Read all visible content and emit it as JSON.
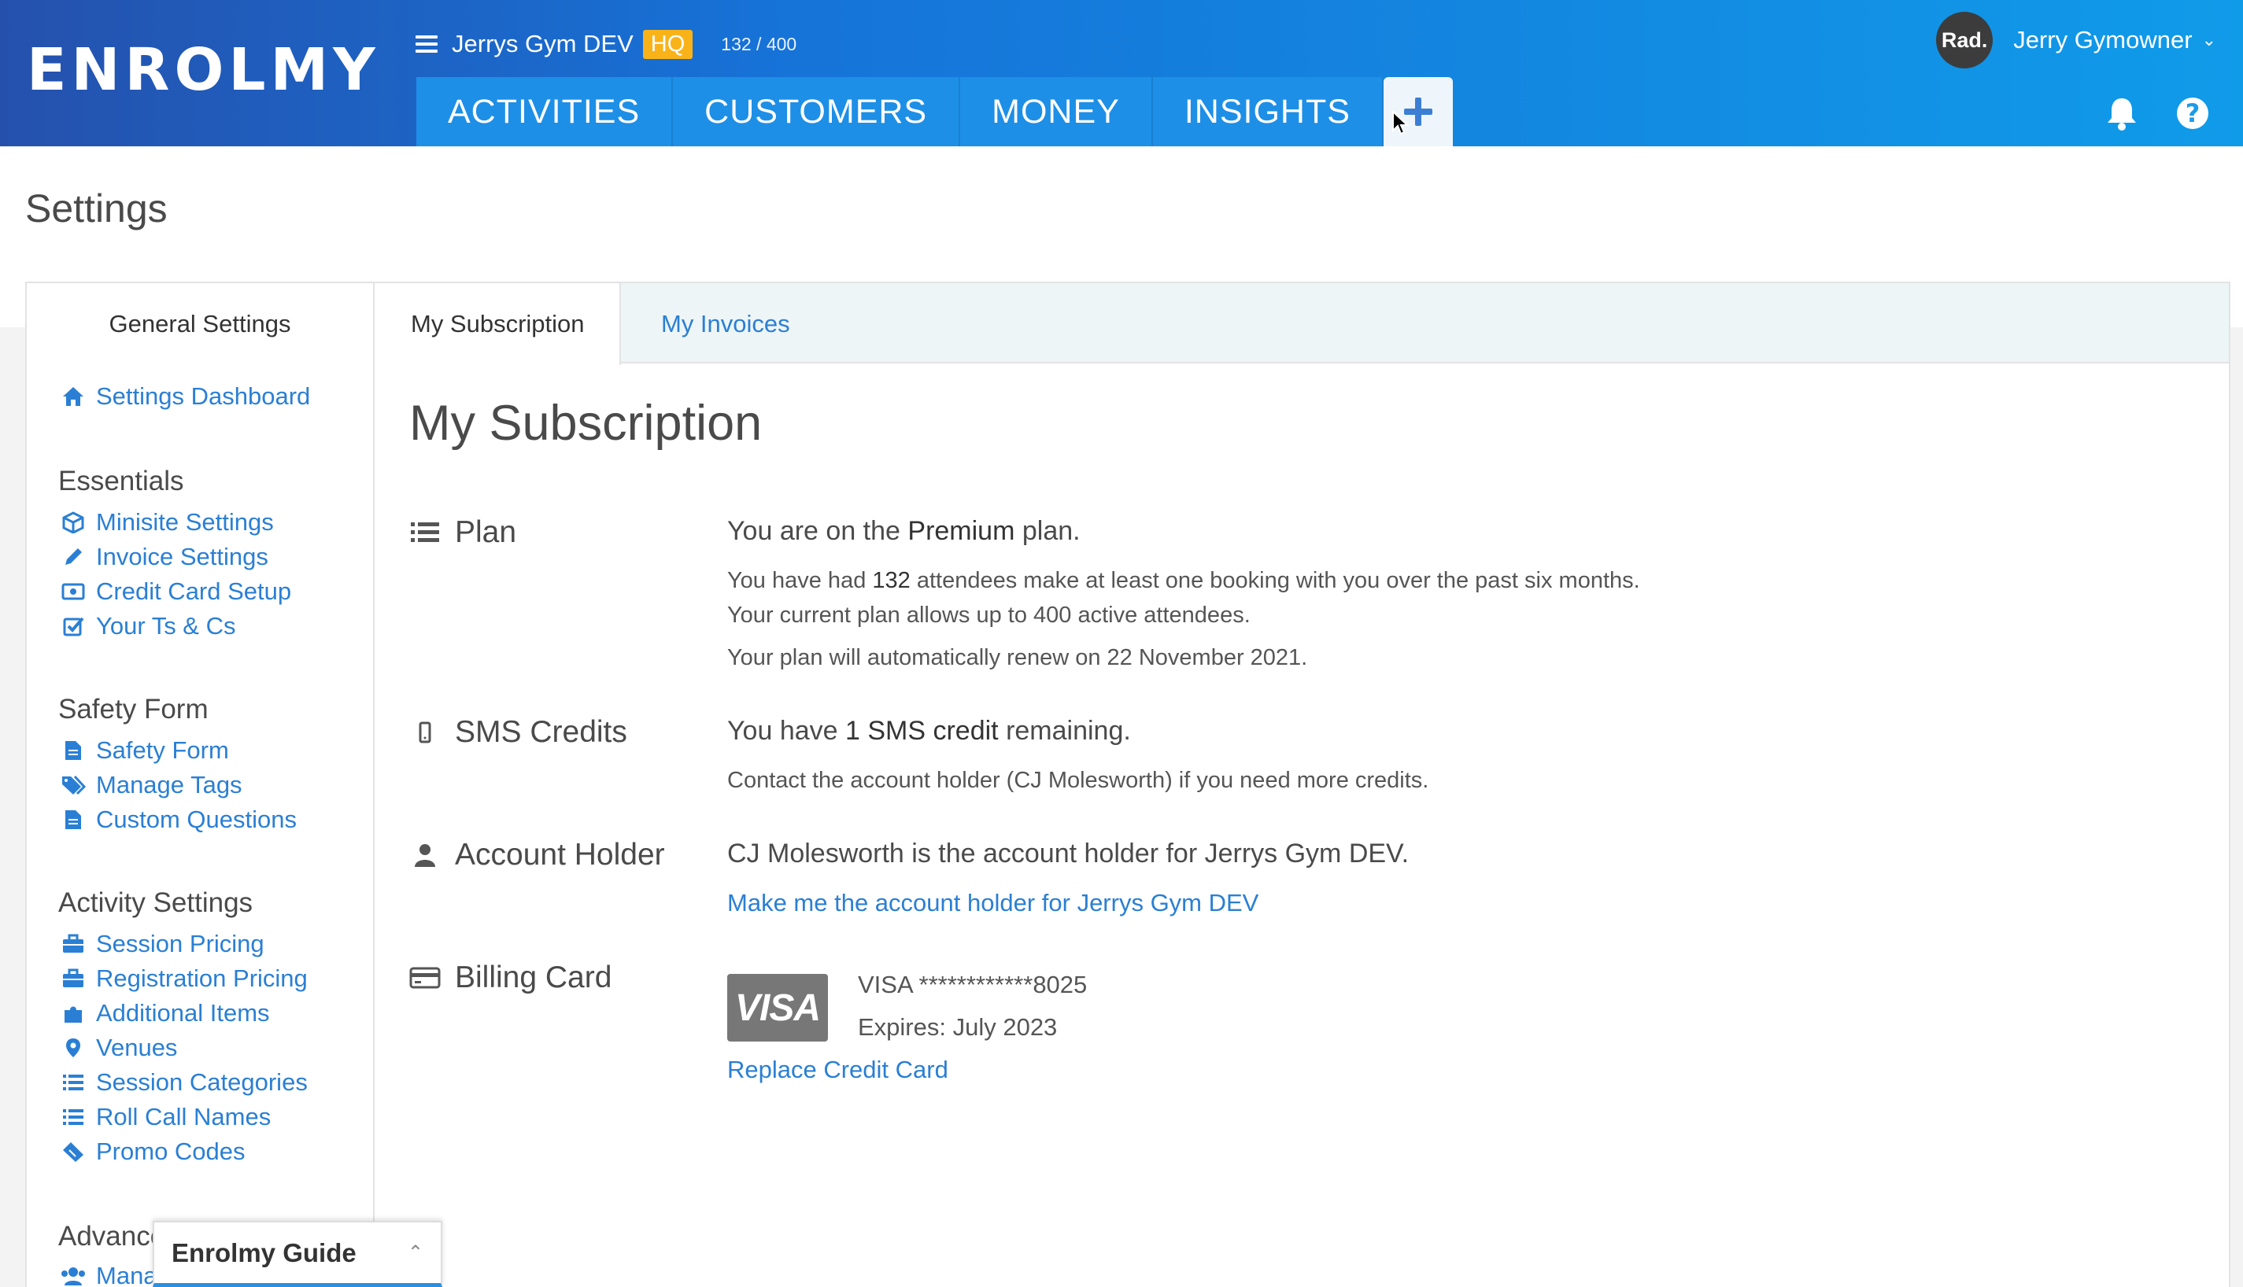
{
  "header": {
    "logo": "ENROLMY",
    "org_name": "Jerrys Gym DEV",
    "org_badge": "HQ",
    "attendee_count": "132 / 400",
    "nav_tabs": [
      "ACTIVITIES",
      "CUSTOMERS",
      "MONEY",
      "INSIGHTS"
    ],
    "user_initials": "Rad.",
    "user_name": "Jerry Gymowner",
    "help_glyph": "?"
  },
  "page": {
    "title": "Settings"
  },
  "sidebar": {
    "heading": "General Settings",
    "dashboard": "Settings Dashboard",
    "sections": [
      {
        "title": "Essentials",
        "items": [
          "Minisite Settings",
          "Invoice Settings",
          "Credit Card Setup",
          "Your Ts & Cs"
        ]
      },
      {
        "title": "Safety Form",
        "items": [
          "Safety Form",
          "Manage Tags",
          "Custom Questions"
        ]
      },
      {
        "title": "Activity Settings",
        "items": [
          "Session Pricing",
          "Registration Pricing",
          "Additional Items",
          "Venues",
          "Session Categories",
          "Roll Call Names",
          "Promo Codes"
        ]
      },
      {
        "title": "Advanced",
        "items": [
          "Manage"
        ]
      }
    ]
  },
  "tabs": {
    "active": "My Subscription",
    "other": "My Invoices"
  },
  "subscription": {
    "title": "My Subscription",
    "plan": {
      "label": "Plan",
      "line1_pre": "You are on the ",
      "line1_bold": "Premium",
      "line1_post": " plan.",
      "line2_pre": "You have had ",
      "line2_bold": "132",
      "line2_post": " attendees make at least one booking with you over the past six months.",
      "line3": "Your current plan allows up to 400 active attendees.",
      "line4": "Your plan will automatically renew on 22 November 2021."
    },
    "sms": {
      "label": "SMS Credits",
      "line1_pre": "You have ",
      "line1_bold": "1 SMS credit",
      "line1_post": " remaining.",
      "line2": "Contact the account holder (CJ Molesworth) if you need more credits."
    },
    "holder": {
      "label": "Account Holder",
      "line1": "CJ Molesworth is the account holder for Jerrys Gym DEV.",
      "link": "Make me the account holder for Jerrys Gym DEV"
    },
    "billing": {
      "label": "Billing Card",
      "brand_logo": "VISA",
      "card": "VISA ************8025",
      "expires": "Expires: July 2023",
      "link": "Replace Credit Card"
    }
  },
  "guide": {
    "title": "Enrolmy Guide"
  }
}
